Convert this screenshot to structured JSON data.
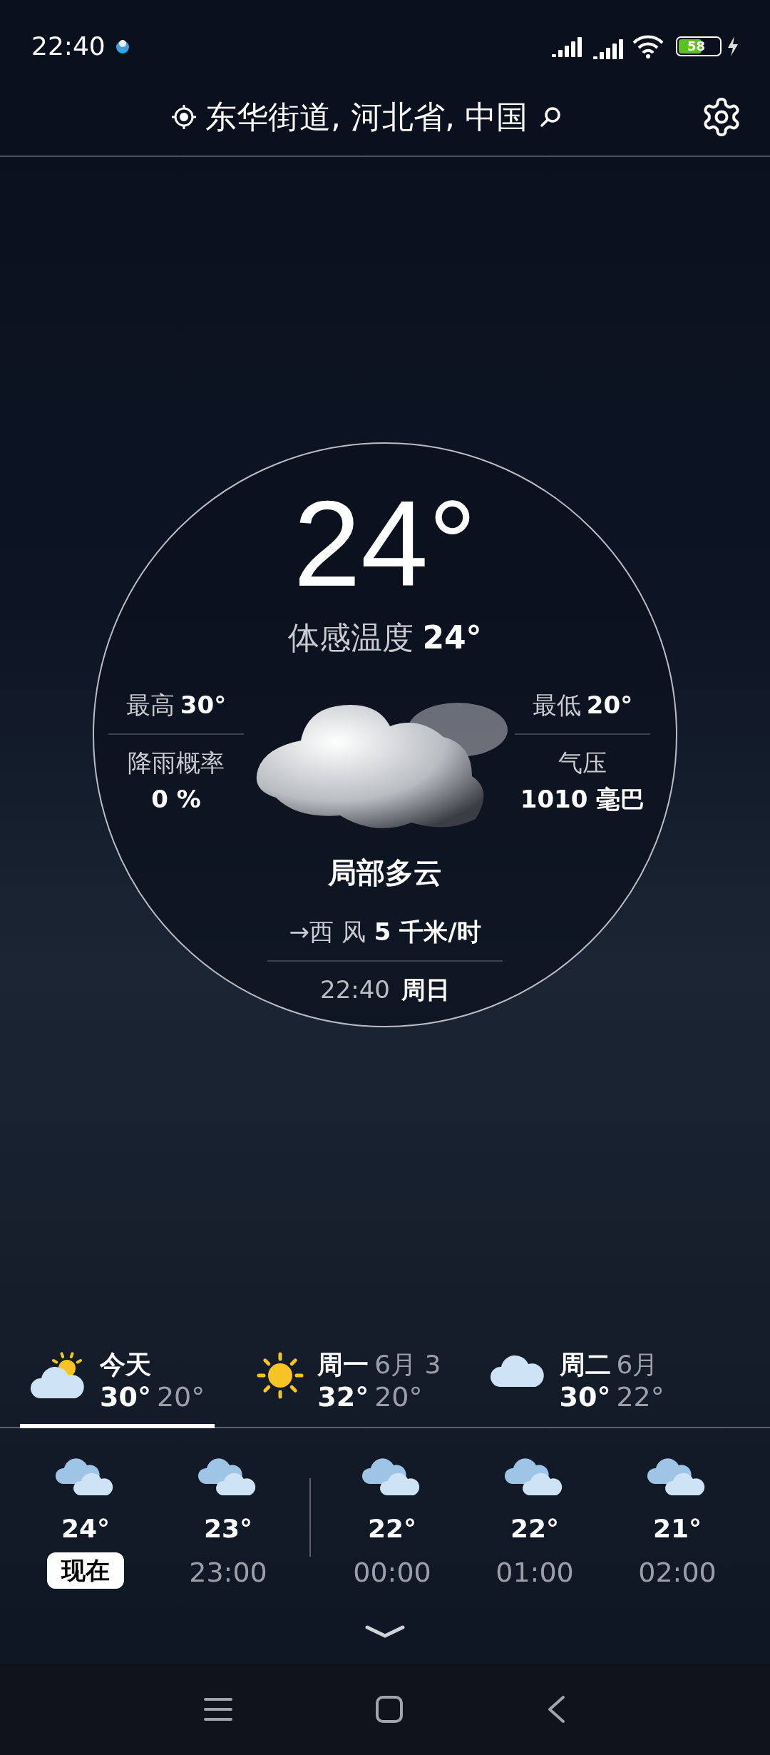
{
  "status_bar": {
    "time": "22:40",
    "battery": "58"
  },
  "header": {
    "location": "东华街道, 河北省, 中国"
  },
  "current": {
    "temperature": "24°",
    "feels_like_label": "体感温度",
    "feels_like": "24°",
    "high_label": "最高",
    "high": "30°",
    "low_label": "最低",
    "low": "20°",
    "precip_label": "降雨概率",
    "precip": "0 %",
    "pressure_label": "气压",
    "pressure": "1010 毫巴",
    "condition": "局部多云",
    "wind_arrow": "→",
    "wind_direction": "西 风",
    "wind_speed": "5 千米/时",
    "time": "22:40",
    "weekday": "周日"
  },
  "days": [
    {
      "name": "今天",
      "high": "30°",
      "low": "20°",
      "kind": "partly_cloudy",
      "selected": true
    },
    {
      "name": "周一",
      "date": "6月 3",
      "high": "32°",
      "low": "20°",
      "kind": "sunny",
      "selected": false
    },
    {
      "name": "周二",
      "date": "6月",
      "high": "30°",
      "low": "22°",
      "kind": "cloudy",
      "selected": false
    }
  ],
  "hour_groups": [
    {
      "hours": [
        {
          "temp": "24°",
          "time": "现在",
          "now": true
        },
        {
          "temp": "23°",
          "time": "23:00",
          "now": false
        }
      ]
    },
    {
      "hours": [
        {
          "temp": "22°",
          "time": "00:00",
          "now": false
        },
        {
          "temp": "22°",
          "time": "01:00",
          "now": false
        },
        {
          "temp": "21°",
          "time": "02:00",
          "now": false
        }
      ]
    }
  ]
}
